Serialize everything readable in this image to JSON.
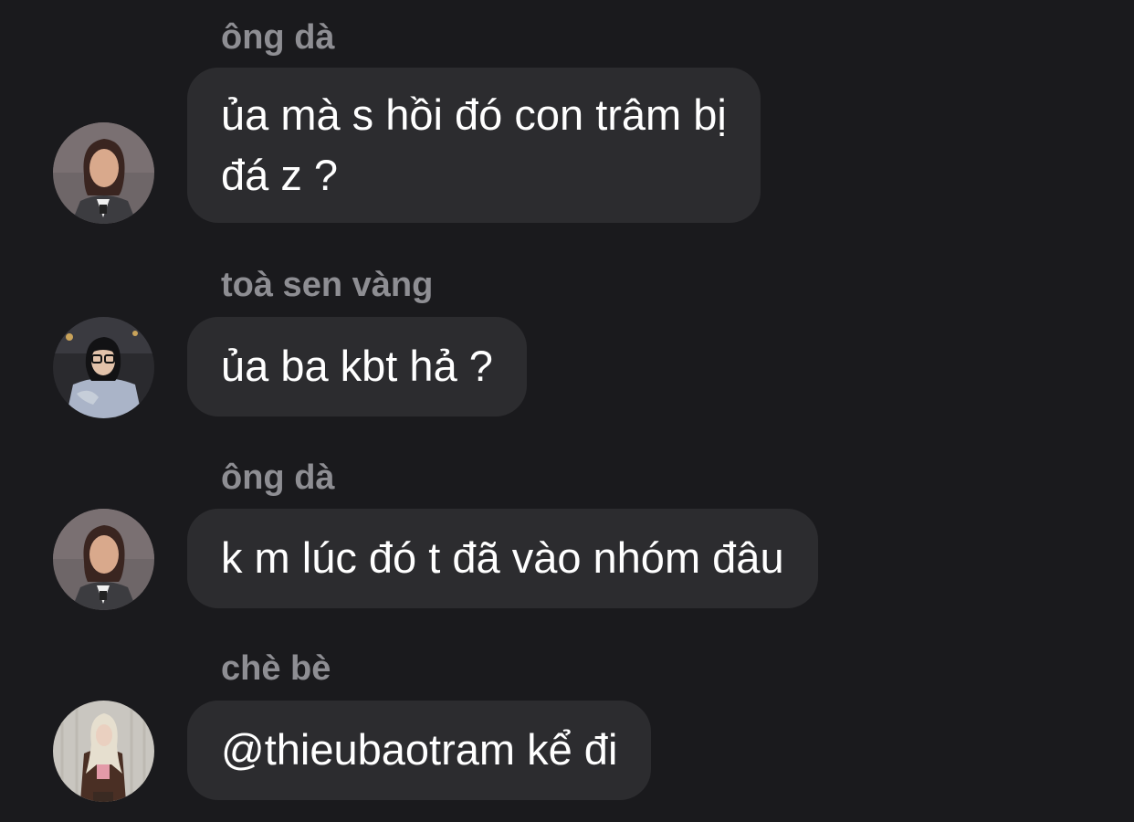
{
  "conversation": {
    "messages": [
      {
        "sender": "ông dà",
        "lines": [
          "ủa mà s hồi đó con trâm bị",
          "đá z ?"
        ],
        "avatar": "woman-avatar-icon"
      },
      {
        "sender": "toà sen vàng",
        "lines": [
          "ủa ba kbt hả ?"
        ],
        "avatar": "glasses-woman-avatar-icon"
      },
      {
        "sender": "ông dà",
        "lines": [
          "k m lúc đó t đã vào nhóm đâu"
        ],
        "avatar": "woman-avatar-icon"
      },
      {
        "sender": "chè bè",
        "lines": [
          "@thieubaotram kể đi"
        ],
        "avatar": "blonde-woman-avatar-icon"
      }
    ]
  },
  "colors": {
    "background": "#1a1a1d",
    "bubble": "#2c2c2f",
    "sender_text": "#8e8e93",
    "message_text": "#ffffff"
  }
}
